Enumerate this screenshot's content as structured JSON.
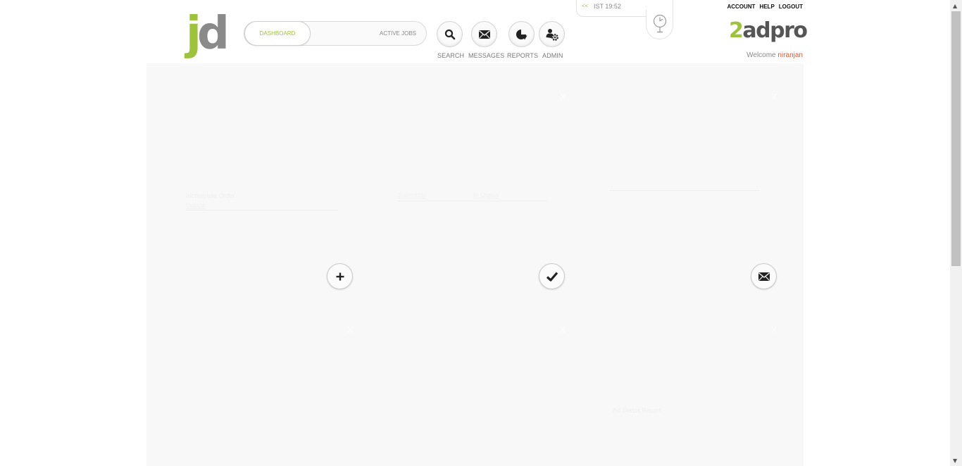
{
  "header": {
    "logo": {
      "j": "j",
      "d": "d"
    },
    "tabs": {
      "dashboard": "DASHBOARD",
      "active_jobs": "ACTIVE JOBS"
    },
    "nav": {
      "search": "SEARCH",
      "messages": "MESSAGES",
      "reports": "REPORTS",
      "admin": "ADMIN"
    },
    "clock": {
      "arrows": "<<",
      "time": "IST 19:52"
    },
    "links": {
      "account": "ACCOUNT",
      "help": "HELP",
      "logout": "LOGOUT"
    },
    "brand": {
      "two": "2",
      "rest": "adpro"
    },
    "welcome": {
      "label": "Welcome",
      "user": "niranjan"
    }
  },
  "dashboard": {
    "close_label": "X",
    "widget1": {
      "line1": "Incomplete Order",
      "line2": "Details"
    },
    "widget2": {
      "col1": "Submitted",
      "col2": "In Queue"
    },
    "widget6": {
      "link": "Ad Status Report"
    }
  },
  "colors": {
    "accent_green": "#9dc23b",
    "user_orange": "#e2582b",
    "panel_bg": "#f8f8f8"
  }
}
